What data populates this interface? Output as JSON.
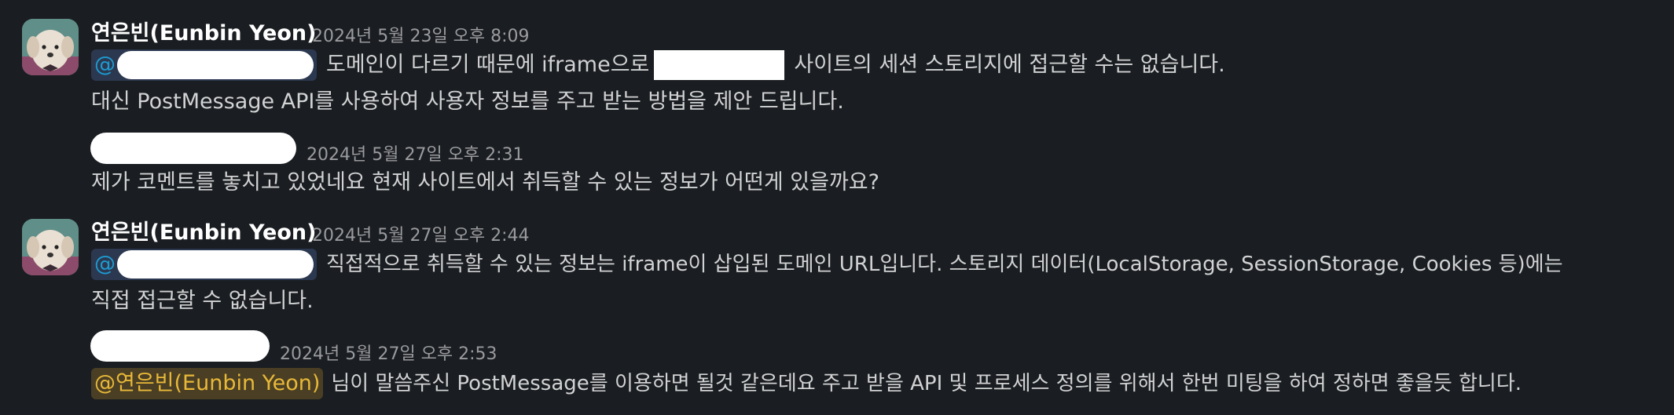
{
  "messages": [
    {
      "author": "연은빈(Eunbin Yeon)",
      "timestamp": "2024년 5월 23일 오후 8:09",
      "mention_prefix": "@",
      "line1_text": "도메인이 다르기 때문에 iframe으로",
      "line1_text_after": "사이트의 세션 스토리지에 접근할 수는 없습니다.",
      "line2_text": "대신 PostMessage API를 사용하여 사용자 정보를 주고 받는 방법을 제안 드립니다."
    },
    {
      "timestamp": "2024년 5월 27일 오후 2:31",
      "line1_text": "제가 코멘트를 놓치고 있었네요 현재 사이트에서 취득할 수 있는 정보가 어떤게 있을까요?"
    },
    {
      "author": "연은빈(Eunbin Yeon)",
      "timestamp": "2024년 5월 27일 오후 2:44",
      "mention_prefix": "@",
      "line1_text": "직접적으로 취득할 수 있는 정보는 iframe이 삽입된 도메인 URL입니다. 스토리지 데이터(LocalStorage, SessionStorage, Cookies 등)에는",
      "line2_text": "직접 접근할 수 없습니다."
    },
    {
      "timestamp": "2024년 5월 27일 오후 2:53",
      "mention_text": "@연은빈(Eunbin Yeon)",
      "line1_text": "님이 말씀주신 PostMessage를 이용하면 될것 같은데요 주고 받을 API 및 프로세스 정의를 위해서 한번 미팅을 하여 정하면 좋을듯 합니다."
    }
  ],
  "colors": {
    "background": "#1a1d21",
    "text": "#d1d2d3",
    "timestamp": "#9a9b9e",
    "mention_bg": "#2b3850",
    "mention_fg": "#1d9bd1",
    "self_mention_bg": "#4a3f24",
    "self_mention_fg": "#e8b838"
  },
  "icons": {
    "avatar": "dog-avatar-icon"
  }
}
